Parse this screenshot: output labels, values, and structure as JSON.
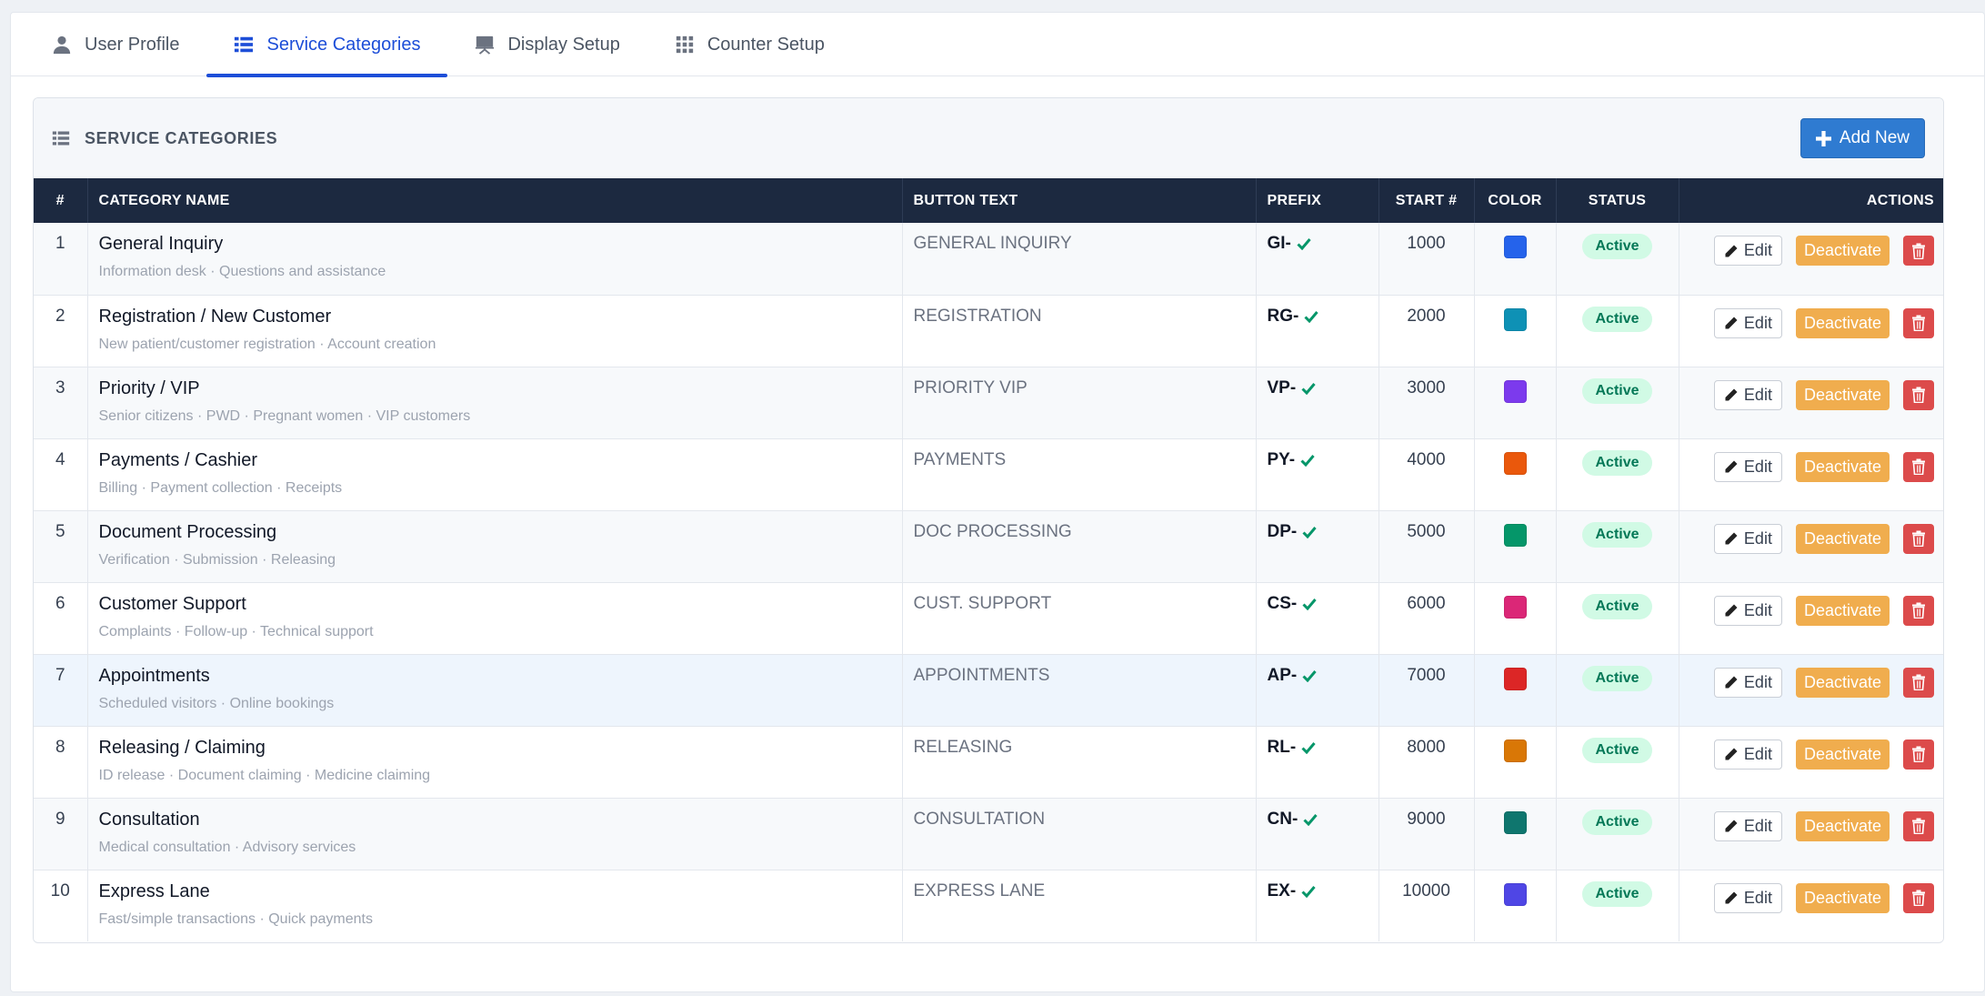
{
  "tabs": [
    {
      "label": "User Profile",
      "icon": "user-icon"
    },
    {
      "label": "Service Categories",
      "icon": "list-icon"
    },
    {
      "label": "Display Setup",
      "icon": "display-icon"
    },
    {
      "label": "Counter Setup",
      "icon": "grid-icon"
    }
  ],
  "active_tab": "Service Categories",
  "card": {
    "title": "SERVICE CATEGORIES",
    "add_label": "Add New"
  },
  "table": {
    "headers": {
      "num": "#",
      "name": "CATEGORY NAME",
      "button_text": "BUTTON TEXT",
      "prefix": "PREFIX",
      "start": "START #",
      "color": "COLOR",
      "status": "STATUS",
      "actions": "ACTIONS"
    },
    "action_labels": {
      "edit": "Edit",
      "deactivate": "Deactivate"
    },
    "rows": [
      {
        "num": "1",
        "name": "General Inquiry",
        "desc": "Information desk · Questions and assistance",
        "button_text": "GENERAL INQUIRY",
        "prefix": "GI-",
        "start": "1000",
        "color": "#2563eb",
        "status": "Active"
      },
      {
        "num": "2",
        "name": "Registration / New Customer",
        "desc": "New patient/customer registration · Account creation",
        "button_text": "REGISTRATION",
        "prefix": "RG-",
        "start": "2000",
        "color": "#0e91b5",
        "status": "Active"
      },
      {
        "num": "3",
        "name": "Priority / VIP",
        "desc": "Senior citizens · PWD · Pregnant women · VIP customers",
        "button_text": "PRIORITY VIP",
        "prefix": "VP-",
        "start": "3000",
        "color": "#7c3aed",
        "status": "Active"
      },
      {
        "num": "4",
        "name": "Payments / Cashier",
        "desc": "Billing · Payment collection · Receipts",
        "button_text": "PAYMENTS",
        "prefix": "PY-",
        "start": "4000",
        "color": "#ea580c",
        "status": "Active"
      },
      {
        "num": "5",
        "name": "Document Processing",
        "desc": "Verification · Submission · Releasing",
        "button_text": "DOC PROCESSING",
        "prefix": "DP-",
        "start": "5000",
        "color": "#059669",
        "status": "Active"
      },
      {
        "num": "6",
        "name": "Customer Support",
        "desc": "Complaints · Follow-up · Technical support",
        "button_text": "CUST. SUPPORT",
        "prefix": "CS-",
        "start": "6000",
        "color": "#db2777",
        "status": "Active"
      },
      {
        "num": "7",
        "name": "Appointments",
        "desc": "Scheduled visitors · Online bookings",
        "button_text": "APPOINTMENTS",
        "prefix": "AP-",
        "start": "7000",
        "color": "#dc2626",
        "status": "Active"
      },
      {
        "num": "8",
        "name": "Releasing / Claiming",
        "desc": "ID release · Document claiming · Medicine claiming",
        "button_text": "RELEASING",
        "prefix": "RL-",
        "start": "8000",
        "color": "#d97706",
        "status": "Active"
      },
      {
        "num": "9",
        "name": "Consultation",
        "desc": "Medical consultation · Advisory services",
        "button_text": "CONSULTATION",
        "prefix": "CN-",
        "start": "9000",
        "color": "#0f766e",
        "status": "Active"
      },
      {
        "num": "10",
        "name": "Express Lane",
        "desc": "Fast/simple transactions · Quick payments",
        "button_text": "EXPRESS LANE",
        "prefix": "EX-",
        "start": "10000",
        "color": "#4f46e5",
        "status": "Active"
      }
    ]
  },
  "colors": {
    "accent": "#1d4ed8",
    "header_bg": "#1c2940",
    "add_button": "#2f7bd1",
    "deactivate": "#f0ad4e",
    "delete": "#dc4b4b",
    "active_badge_bg": "#d1fae5",
    "active_badge_text": "#047857",
    "check": "#059669"
  }
}
